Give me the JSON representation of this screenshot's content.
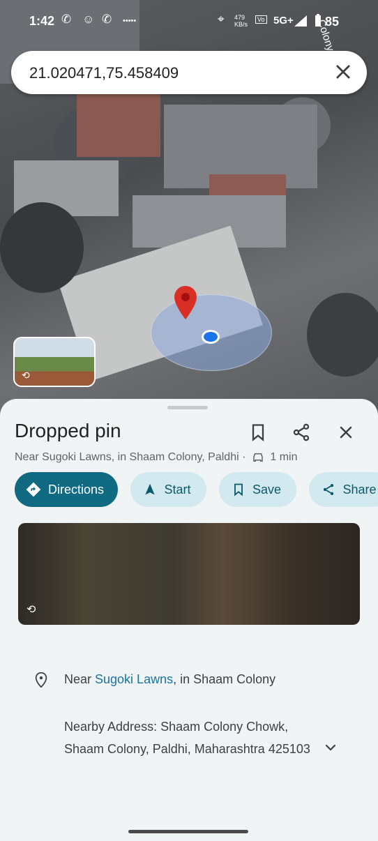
{
  "status_bar": {
    "time": "1:42",
    "net_speed": "479 KB/s",
    "network": "5G+",
    "battery": "85",
    "road_label": "Colony"
  },
  "search": {
    "value": "21.020471,75.458409",
    "clear_icon": "close-icon"
  },
  "place": {
    "title": "Dropped pin",
    "subtitle_area": "Near Sugoki Lawns, in Shaam Colony, Paldhi",
    "subtitle_sep": "·",
    "drive_time": "1 min"
  },
  "actions": [
    {
      "label": "Directions",
      "icon": "directions-icon"
    },
    {
      "label": "Start",
      "icon": "navigation-arrow-icon"
    },
    {
      "label": "Save",
      "icon": "bookmark-icon"
    },
    {
      "label": "Share",
      "icon": "share-icon"
    }
  ],
  "details": {
    "near_prefix": "Near ",
    "near_link": "Sugoki Lawns",
    "near_suffix": ", in Shaam Colony",
    "nearby_address": "Nearby Address: Shaam Colony Chowk, Shaam Colony, Paldhi, Maharashtra 425103"
  },
  "colors": {
    "primary_chip": "#0f6a82",
    "secondary_chip": "#d2e9f0",
    "link": "#1a73a0"
  }
}
